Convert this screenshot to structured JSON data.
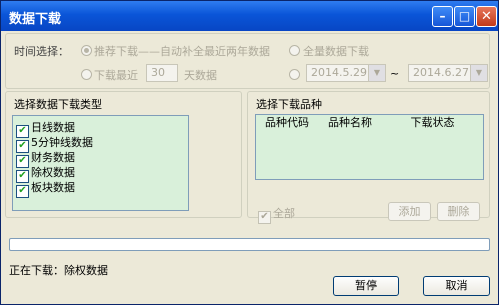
{
  "window": {
    "title": "数据下载"
  },
  "time": {
    "label": "时间选择：",
    "option_recommended": "推荐下载——自动补全最近两年数据",
    "option_full": "全量数据下载",
    "option_recent_prefix": "下载最近",
    "recent_days": "30",
    "option_recent_suffix": "天数据",
    "date_start": "2014.5.29",
    "date_sep": "~",
    "date_end": "2014.6.27"
  },
  "types": {
    "title": "选择数据下载类型",
    "items": [
      {
        "label": "日线数据",
        "checked": true
      },
      {
        "label": "5分钟线数据",
        "checked": true
      },
      {
        "label": "财务数据",
        "checked": true
      },
      {
        "label": "除权数据",
        "checked": true
      },
      {
        "label": "板块数据",
        "checked": true
      }
    ]
  },
  "varieties": {
    "title": "选择下载品种",
    "columns": [
      "品种代码",
      "品种名称",
      "下载状态"
    ],
    "select_all_label": "全部",
    "add_label": "添加",
    "remove_label": "删除"
  },
  "progress": {
    "fraction": 0.0
  },
  "status": {
    "text": "正在下载：除权数据"
  },
  "buttons": {
    "pause": "暂停",
    "cancel": "取消"
  },
  "colors": {
    "title_bar": "#0a55d8",
    "list_background": "#d9f0da",
    "check": "#21a121"
  }
}
